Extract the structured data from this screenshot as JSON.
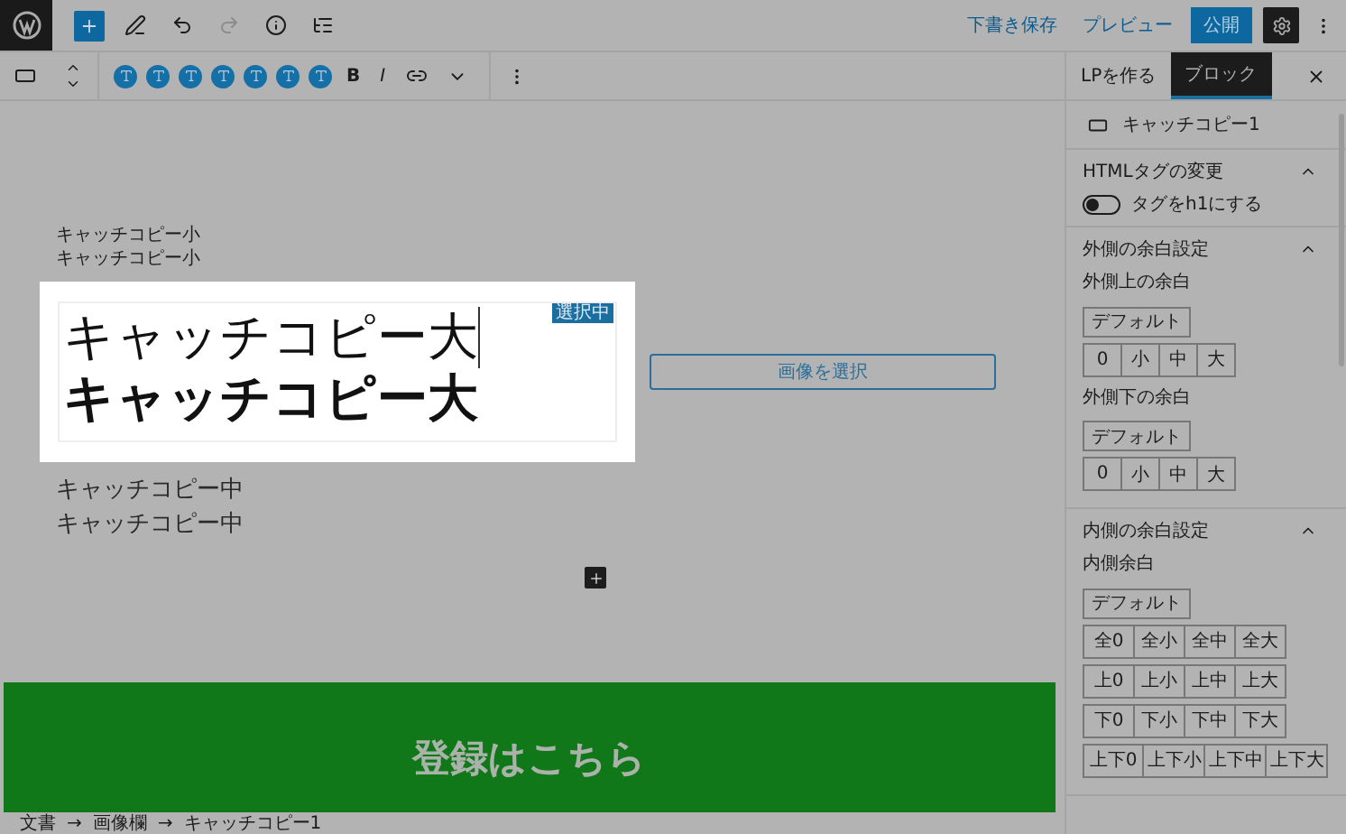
{
  "header": {
    "save_draft": "下書き保存",
    "preview": "プレビュー",
    "publish": "公開",
    "settings_active": true,
    "redo_disabled": true
  },
  "format_toolbar": {
    "bold": "B",
    "italic": "I"
  },
  "canvas": {
    "small_lines": [
      "キャッチコピー小",
      "キャッチコピー小"
    ],
    "selected_block": {
      "badge": "選択中",
      "lines": [
        {
          "text": "キャッチコピー大",
          "kind": "serif"
        },
        {
          "text": "キャッチコピー大",
          "kind": "bold"
        }
      ]
    },
    "image_button": "画像を選択",
    "medium_lines": [
      "キャッチコピー中",
      "キャッチコピー中"
    ],
    "banner": {
      "title": "登録はこちら"
    }
  },
  "breadcrumb": {
    "separator": "→",
    "items": [
      "文書",
      "画像欄",
      "キャッチコピー1"
    ]
  },
  "sidebar": {
    "tabs": [
      {
        "label": "LPを作る",
        "selected": false
      },
      {
        "label": "ブロック",
        "selected": true
      }
    ],
    "block_name": "キャッチコピー1",
    "panels": [
      {
        "title": "HTMLタグの変更",
        "expanded": true,
        "toggle": {
          "label": "タグをh1にする",
          "on": false
        }
      },
      {
        "title": "外側の余白設定",
        "expanded": true,
        "groups": [
          {
            "label": "外側上の余白",
            "default": "デフォルト",
            "rows": [
              [
                "0",
                "小",
                "中",
                "大"
              ]
            ]
          },
          {
            "label": "外側下の余白",
            "default": "デフォルト",
            "rows": [
              [
                "0",
                "小",
                "中",
                "大"
              ]
            ]
          }
        ]
      },
      {
        "title": "内側の余白設定",
        "expanded": true,
        "groups": [
          {
            "label": "内側余白",
            "default": "デフォルト",
            "rows": [
              [
                "全0",
                "全小",
                "全中",
                "全大"
              ],
              [
                "上0",
                "上小",
                "上中",
                "上大"
              ],
              [
                "下0",
                "下小",
                "下中",
                "下大"
              ],
              [
                "上下0",
                "上下小",
                "上下中",
                "上下大"
              ]
            ]
          }
        ]
      }
    ]
  }
}
